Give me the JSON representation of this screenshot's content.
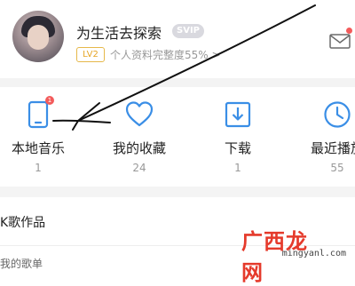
{
  "profile": {
    "username": "为生活去探索",
    "badge": "SVIP",
    "level": "LV2",
    "completion_text": "个人资料完整度55%",
    "chevron": ">"
  },
  "quick_actions": [
    {
      "label": "本地音乐",
      "count": "1",
      "icon": "phone-icon"
    },
    {
      "label": "我的收藏",
      "count": "24",
      "icon": "heart-icon"
    },
    {
      "label": "下载",
      "count": "1",
      "icon": "download-icon"
    },
    {
      "label": "最近播放",
      "count": "55",
      "icon": "clock-icon"
    }
  ],
  "section": {
    "title": "K歌作品"
  },
  "bottom_partial": "我的歌单",
  "watermark": {
    "brand": "广西龙网",
    "url": "mingyanl.com"
  },
  "colors": {
    "accent": "#3a8ee6",
    "badge_red": "#f35b5b",
    "watermark_red": "#e53a2b"
  }
}
